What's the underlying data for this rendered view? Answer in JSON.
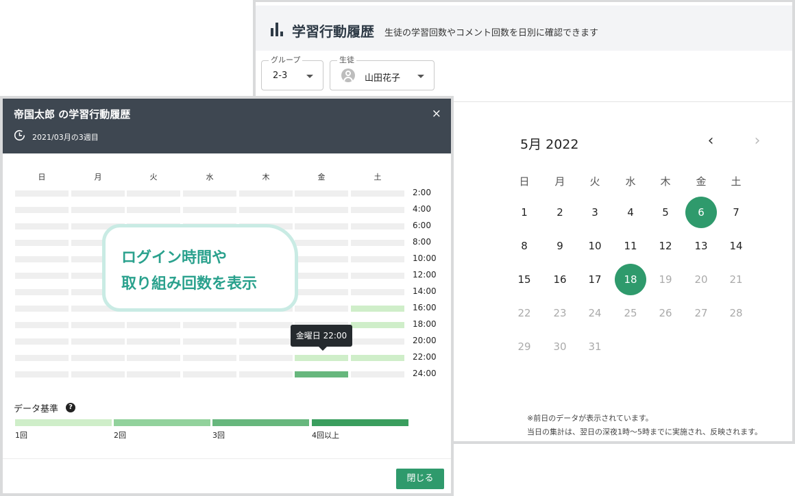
{
  "back_window": {
    "title": "学習行動履歴",
    "subtitle": "生徒の学習回数やコメント回数を日別に確認できます",
    "group_select": {
      "legend": "グループ",
      "value": "2-3"
    },
    "student_select": {
      "legend": "生徒",
      "value": "山田花子"
    },
    "calendar": {
      "month_label": "5月 2022",
      "prev_icon": "chevron-left-icon",
      "next_icon": "chevron-right-icon",
      "weekdays": [
        "日",
        "月",
        "火",
        "水",
        "木",
        "金",
        "土"
      ],
      "days": [
        "1",
        "2",
        "3",
        "4",
        "5",
        "6",
        "7",
        "8",
        "9",
        "10",
        "11",
        "12",
        "13",
        "14",
        "15",
        "16",
        "17",
        "18",
        "19",
        "20",
        "21",
        "22",
        "23",
        "24",
        "25",
        "26",
        "27",
        "28",
        "29",
        "30",
        "31"
      ],
      "first_weekday_index": 0,
      "highlighted_days": [
        6,
        18
      ],
      "last_active_day": 18,
      "accent_color": "#2f9a6c"
    },
    "note": {
      "line1": "※前日のデータが表示されています。",
      "line2": "当日の集計は、翌日の深夜1時〜5時までに実施され、反映されます。"
    }
  },
  "modal": {
    "title": "帝国太郎 の学習行動履歴",
    "close_label": "×",
    "week_label": "2021/03月の3週目",
    "weekdays": [
      "日",
      "月",
      "火",
      "水",
      "木",
      "金",
      "土"
    ],
    "time_labels": [
      "2:00",
      "4:00",
      "6:00",
      "8:00",
      "10:00",
      "12:00",
      "14:00",
      "16:00",
      "18:00",
      "20:00",
      "22:00",
      "24:00"
    ],
    "activity_levels": [
      [
        0,
        0,
        0,
        0,
        0,
        0,
        0
      ],
      [
        0,
        0,
        0,
        0,
        0,
        0,
        0
      ],
      [
        0,
        0,
        0,
        0,
        0,
        0,
        0
      ],
      [
        0,
        0,
        0,
        0,
        0,
        0,
        0
      ],
      [
        0,
        0,
        0,
        0,
        0,
        0,
        0
      ],
      [
        0,
        0,
        0,
        0,
        0,
        0,
        0
      ],
      [
        0,
        0,
        0,
        0,
        0,
        0,
        0
      ],
      [
        0,
        0,
        0,
        0,
        0,
        0,
        1
      ],
      [
        0,
        0,
        0,
        0,
        0,
        0,
        1
      ],
      [
        0,
        0,
        0,
        0,
        0,
        0,
        0
      ],
      [
        0,
        0,
        0,
        0,
        0,
        1,
        1
      ],
      [
        0,
        0,
        0,
        0,
        0,
        3,
        0
      ]
    ],
    "level_colors": [
      "#efefef",
      "#cfeec9",
      "#92d29c",
      "#67b77d",
      "#2f9a6c"
    ],
    "tooltip": "金曜日 22:00",
    "callout": {
      "line1": "ログイン時間や",
      "line2": "取り組み回数を表示"
    },
    "legend": {
      "title": "データ基準",
      "help_icon": "help-circle-icon",
      "help_glyph": "?",
      "items": [
        {
          "label": "1回",
          "color": "#cfeec9"
        },
        {
          "label": "2回",
          "color": "#92d29c"
        },
        {
          "label": "3回",
          "color": "#67b77d"
        },
        {
          "label": "4回以上",
          "color": "#3a9e5e"
        }
      ]
    },
    "close_button": "閉じる"
  }
}
